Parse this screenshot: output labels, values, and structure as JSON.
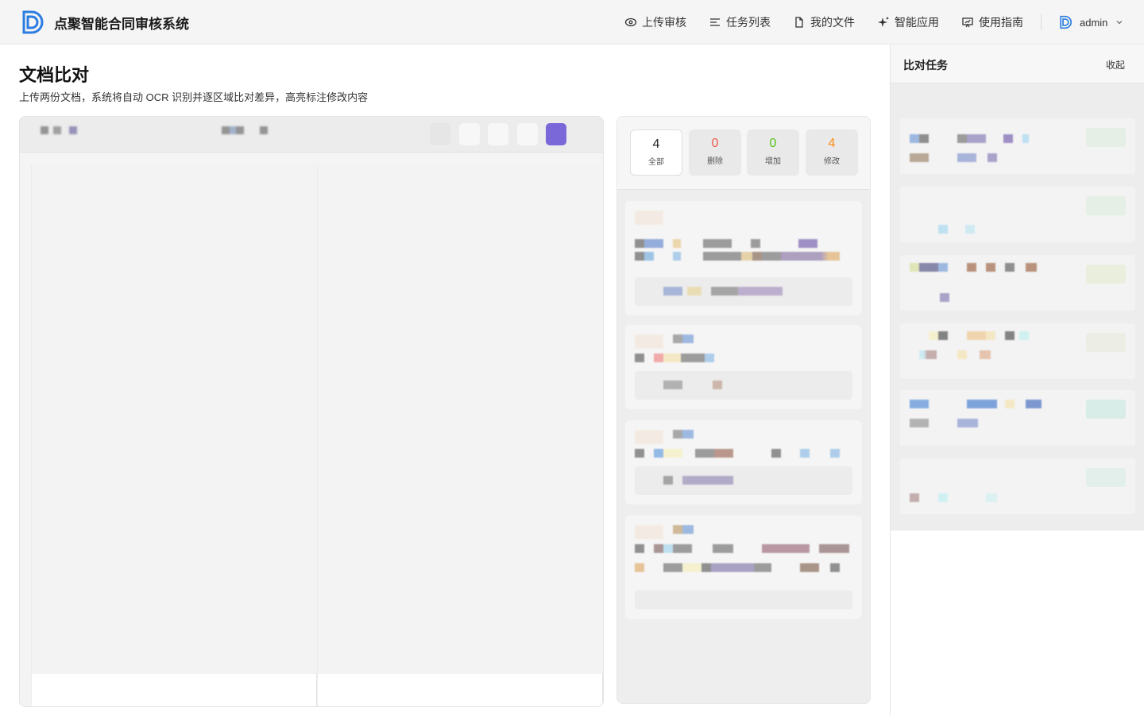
{
  "app": {
    "name": "点聚智能合同审核系统"
  },
  "nav": {
    "items": [
      {
        "label": "上传审核",
        "icon": "eye-icon"
      },
      {
        "label": "任务列表",
        "icon": "list-icon"
      },
      {
        "label": "我的文件",
        "icon": "file-icon"
      },
      {
        "label": "智能应用",
        "icon": "sparkle-icon"
      },
      {
        "label": "使用指南",
        "icon": "guide-icon"
      }
    ],
    "user": "admin"
  },
  "page": {
    "title": "文档比对",
    "subtitle": "上传两份文档，系统将自动 OCR 识别并逐区域比对差异，高亮标注修改内容"
  },
  "diff_summary": {
    "tabs": [
      {
        "value": "4",
        "label": "全部",
        "color": "#222222"
      },
      {
        "value": "0",
        "label": "删除",
        "color": "#f05a4a"
      },
      {
        "value": "0",
        "label": "增加",
        "color": "#52c41a"
      },
      {
        "value": "4",
        "label": "修改",
        "color": "#fa8c16"
      }
    ]
  },
  "tasks": {
    "title": "比对任务",
    "collapse_label": "收起"
  },
  "colors": {
    "accent": "#7a68d8",
    "logo": "#2b7de1"
  }
}
